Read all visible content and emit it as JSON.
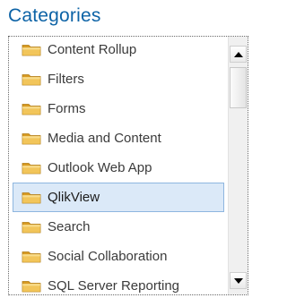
{
  "title": "Categories",
  "colors": {
    "title": "#0d63a6",
    "folder": "#e5b548",
    "selection": "#dbe9f8"
  },
  "categories": {
    "items": [
      {
        "label": "Content Rollup",
        "icon": "folder-icon"
      },
      {
        "label": "Filters",
        "icon": "folder-icon"
      },
      {
        "label": "Forms",
        "icon": "folder-icon"
      },
      {
        "label": "Media and Content",
        "icon": "folder-icon"
      },
      {
        "label": "Outlook Web App",
        "icon": "folder-icon"
      },
      {
        "label": "QlikView",
        "icon": "folder-icon",
        "selected": true
      },
      {
        "label": "Search",
        "icon": "folder-icon"
      },
      {
        "label": "Social Collaboration",
        "icon": "folder-icon"
      },
      {
        "label": "SQL Server Reporting",
        "icon": "folder-icon"
      }
    ],
    "selected_index": 5
  },
  "scrollbar": {
    "up_icon": "arrow-up-icon",
    "down_icon": "arrow-down-icon"
  }
}
